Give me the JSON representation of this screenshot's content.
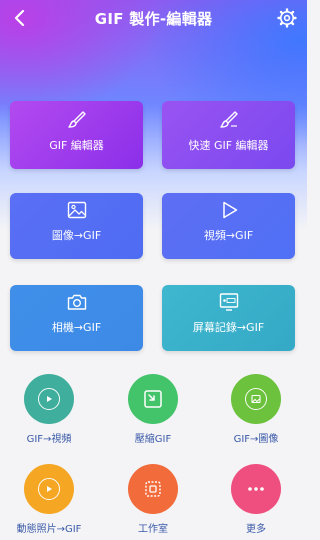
{
  "header": {
    "title": "GIF 製作-編輯器"
  },
  "cards": [
    {
      "label": "GIF 編輯器",
      "icon": "brush-icon"
    },
    {
      "label": "快速 GIF 編輯器",
      "icon": "quick-brush-icon"
    },
    {
      "label": "圖像→GIF",
      "icon": "image-icon"
    },
    {
      "label": "視頻→GIF",
      "icon": "video-play-icon"
    },
    {
      "label": "相機→GIF",
      "icon": "camera-icon"
    },
    {
      "label": "屏幕記錄→GIF",
      "icon": "screen-record-icon"
    }
  ],
  "circles": [
    {
      "label": "GIF→視頻",
      "icon": "gif-to-video-icon",
      "color": "#3fae9c"
    },
    {
      "label": "壓縮GIF",
      "icon": "compress-icon",
      "color": "#43c36a"
    },
    {
      "label": "GIF→圖像",
      "icon": "gif-to-image-icon",
      "color": "#6cc13d"
    },
    {
      "label": "動態照片→GIF",
      "icon": "live-photo-icon",
      "color": "#f5a623"
    },
    {
      "label": "工作室",
      "icon": "studio-icon",
      "color": "#f26b3a"
    },
    {
      "label": "更多",
      "icon": "more-icon",
      "color": "#ef4f7f"
    }
  ],
  "colors": {
    "accent": "#6f86ff",
    "label_text": "#3a5aa8"
  }
}
